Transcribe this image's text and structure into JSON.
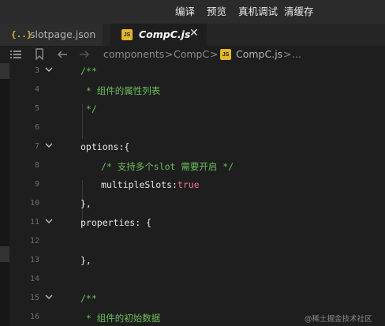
{
  "menu": {
    "items": [
      "编译",
      "预览",
      "真机调试",
      "清缓存"
    ]
  },
  "tabs": [
    {
      "icon": "{..}",
      "label": "slotpage.json"
    },
    {
      "icon": "JS",
      "label": "CompC.js",
      "close": "✕"
    }
  ],
  "breadcrumb": {
    "seg1": "components",
    "sep1": ">",
    "seg2": "CompC",
    "sep2": ">",
    "file_icon": "JS",
    "seg3": "CompC.js",
    "sep3": ">",
    "ellipsis": "..."
  },
  "editor": {
    "lines": [
      {
        "num": "3",
        "text": "/**"
      },
      {
        "num": "4",
        "text": " * 组件的属性列表"
      },
      {
        "num": "5",
        "text": " */"
      },
      {
        "num": "6",
        "text": ""
      },
      {
        "num": "7",
        "text": "options:{"
      },
      {
        "num": "8",
        "text": "/* 支持多个slot 需要开启 */"
      },
      {
        "num": "9",
        "key": "multipleSlots:",
        "value": "true"
      },
      {
        "num": "10",
        "text": "},"
      },
      {
        "num": "11",
        "text": "properties: {"
      },
      {
        "num": "12",
        "text": ""
      },
      {
        "num": "13",
        "text": "},"
      },
      {
        "num": "14",
        "text": ""
      },
      {
        "num": "15",
        "text": "/**"
      },
      {
        "num": "16",
        "text": " * 组件的初始数据"
      }
    ]
  },
  "watermark": "@稀土掘金技术社区",
  "colors": {
    "background": "#1e1e1e",
    "comment": "#6bbd5b",
    "boolean": "#f0768b",
    "js_badge": "#e3b72b"
  }
}
